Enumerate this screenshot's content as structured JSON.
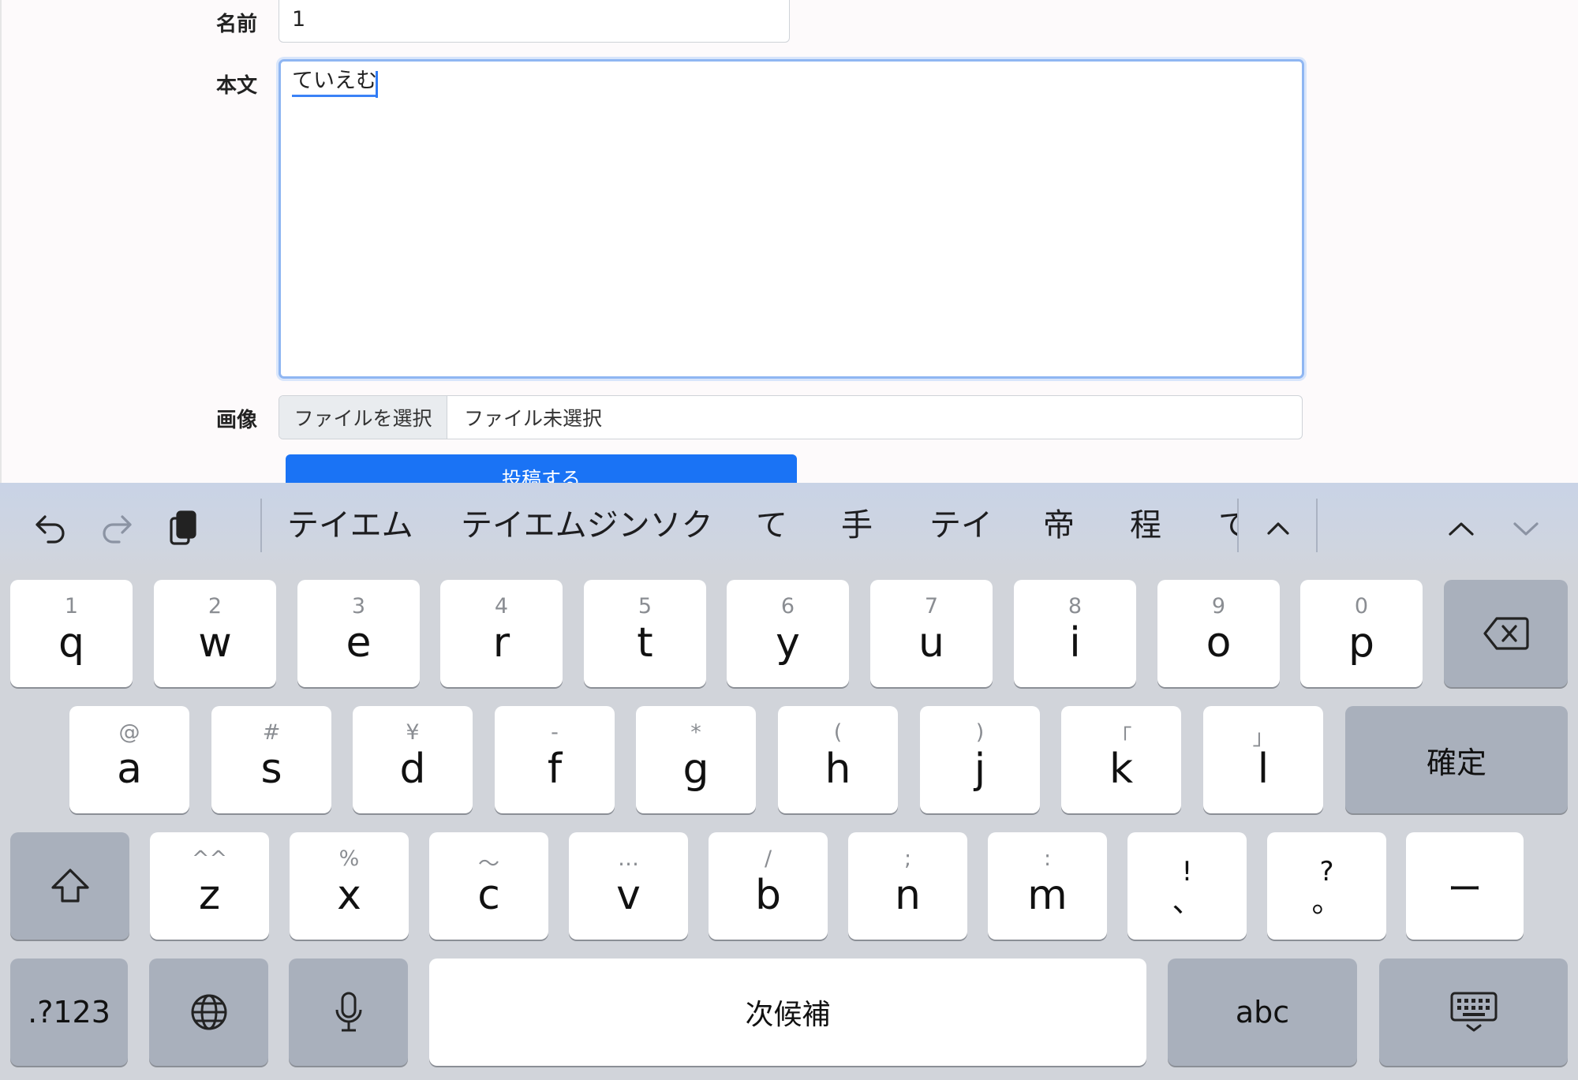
{
  "form": {
    "name_label": "名前",
    "name_value": "1",
    "body_label": "本文",
    "body_composing": "ていえむ",
    "image_label": "画像",
    "file_button": "ファイルを選択",
    "file_status": "ファイル未選択",
    "submit_label": "投稿する"
  },
  "toolbar": {
    "candidates": [
      "テイエム",
      "テイエムジンソク",
      "て",
      "手",
      "テイ",
      "帝",
      "程",
      "て"
    ]
  },
  "keyboard": {
    "row1": [
      {
        "sub": "1",
        "main": "q"
      },
      {
        "sub": "2",
        "main": "w"
      },
      {
        "sub": "3",
        "main": "e"
      },
      {
        "sub": "4",
        "main": "r"
      },
      {
        "sub": "5",
        "main": "t"
      },
      {
        "sub": "6",
        "main": "y"
      },
      {
        "sub": "7",
        "main": "u"
      },
      {
        "sub": "8",
        "main": "i"
      },
      {
        "sub": "9",
        "main": "o"
      },
      {
        "sub": "0",
        "main": "p"
      }
    ],
    "row2": [
      {
        "sub": "@",
        "main": "a"
      },
      {
        "sub": "#",
        "main": "s"
      },
      {
        "sub": "¥",
        "main": "d"
      },
      {
        "sub": "-",
        "main": "f"
      },
      {
        "sub": "*",
        "main": "g"
      },
      {
        "sub": "(",
        "main": "h"
      },
      {
        "sub": ")",
        "main": "j"
      },
      {
        "sub": "「",
        "main": "k"
      },
      {
        "sub": "」",
        "main": "l"
      }
    ],
    "row3": [
      {
        "sub": "^^",
        "main": "z"
      },
      {
        "sub": "%",
        "main": "x"
      },
      {
        "sub": "〜",
        "main": "c"
      },
      {
        "sub": "…",
        "main": "v"
      },
      {
        "sub": "/",
        "main": "b"
      },
      {
        "sub": ";",
        "main": "n"
      },
      {
        "sub": ":",
        "main": "m"
      },
      {
        "sub": "!",
        "main": "、"
      },
      {
        "sub": "?",
        "main": "。"
      }
    ],
    "confirm_label": "確定",
    "dash_label": "ー",
    "numbers_label": ".?123",
    "space_label": "次候補",
    "abc_label": "abc"
  }
}
